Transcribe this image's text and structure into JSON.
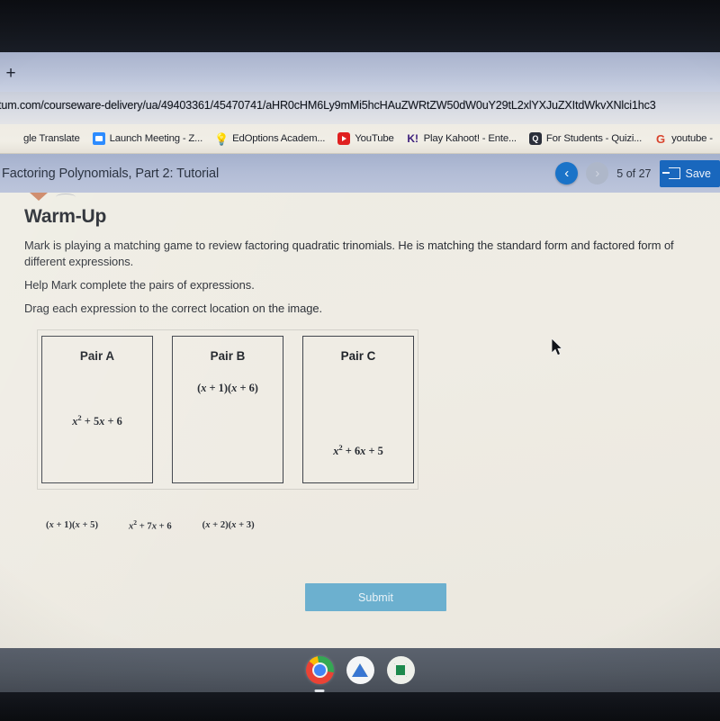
{
  "browser": {
    "new_tab_label": "+",
    "url": "tum.com/courseware-delivery/ua/49403361/45470741/aHR0cHM6Ly9mMi5hcHAuZWRtZW50dW0uY29tL2xlYXJuZXItdWkvXNlci1hc3",
    "bookmarks": [
      {
        "label": "gle Translate",
        "icon": "translate-icon"
      },
      {
        "label": "Launch Meeting - Z...",
        "icon": "zoom-icon"
      },
      {
        "label": "EdOptions Academ...",
        "icon": "lightbulb-icon"
      },
      {
        "label": "YouTube",
        "icon": "youtube-icon"
      },
      {
        "label": "Play Kahoot! - Ente...",
        "icon": "kahoot-icon"
      },
      {
        "label": "For Students - Quizi...",
        "icon": "quizizz-icon"
      },
      {
        "label": "youtube -",
        "icon": "google-icon"
      }
    ]
  },
  "app_header": {
    "title": "Factoring Polynomials, Part 2: Tutorial",
    "prev_label": "‹",
    "next_label": "›",
    "page_counter": "5 of 27",
    "save_label": "Save"
  },
  "content": {
    "heading": "Warm-Up",
    "paragraph_1": "Mark is playing a matching game to review factoring quadratic trinomials. He is matching the standard form and factored form of different expressions.",
    "paragraph_2": "Help Mark complete the pairs of expressions.",
    "paragraph_3": "Drag each expression to the correct location on the image.",
    "pairs": [
      {
        "label": "Pair A",
        "expression": "x² + 5x + 6",
        "position": "bottom"
      },
      {
        "label": "Pair B",
        "expression": "(x + 1)(x + 6)",
        "position": "top"
      },
      {
        "label": "Pair C",
        "expression": "x² + 6x + 5",
        "position": "lower"
      }
    ],
    "drag_tokens": [
      "(x + 1)(x + 5)",
      "x² + 7x + 6",
      "(x + 2)(x + 3)"
    ],
    "submit_label": "Submit"
  },
  "shelf": {
    "icons": [
      {
        "name": "chrome-icon"
      },
      {
        "name": "google-drive-icon"
      },
      {
        "name": "sheets-icon"
      }
    ]
  },
  "colors": {
    "header_blue": "#b3bdd6",
    "save_button": "#1967bd",
    "submit_button": "#6cb0cf",
    "page_background": "#efece4",
    "shelf": "#525963"
  }
}
